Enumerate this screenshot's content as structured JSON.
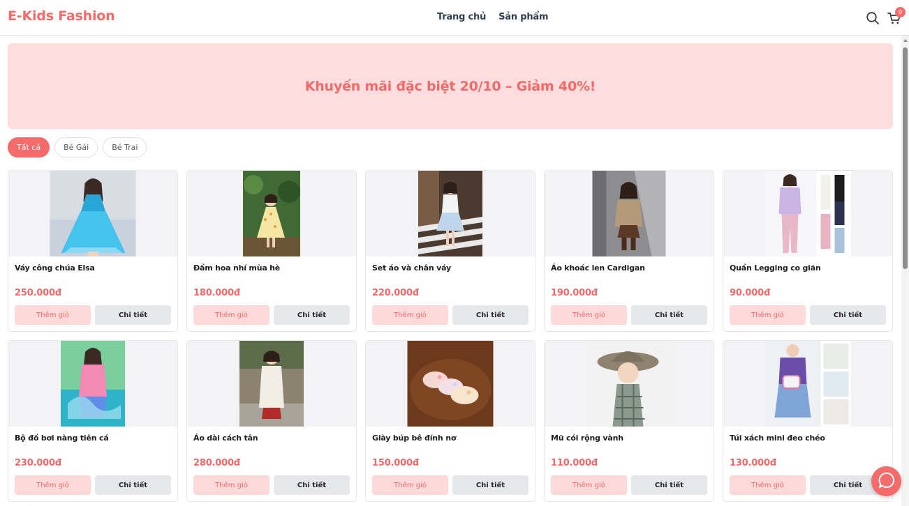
{
  "header": {
    "logo": "E-Kids Fashion",
    "nav": [
      "Trang chủ",
      "Sản phẩm"
    ],
    "cart_count": "0"
  },
  "banner": {
    "text": "Khuyến mãi đặc biệt 20/10 – Giảm 40%!"
  },
  "filters": [
    "Tất cả",
    "Bé Gái",
    "Bé Trai"
  ],
  "active_filter": "Tất cả",
  "products": [
    {
      "name": "Váy công chúa Elsa",
      "price": "250.000đ",
      "add_label": "Thêm giỏ",
      "detail_label": "Chi tiết"
    },
    {
      "name": "Đầm hoa nhí mùa hè",
      "price": "180.000đ",
      "add_label": "Thêm giỏ",
      "detail_label": "Chi tiết"
    },
    {
      "name": "Set áo và chân váy",
      "price": "220.000đ",
      "add_label": "Thêm giỏ",
      "detail_label": "Chi tiết"
    },
    {
      "name": "Áo khoác len Cardigan",
      "price": "190.000đ",
      "add_label": "Thêm giỏ",
      "detail_label": "Chi tiết"
    },
    {
      "name": "Quần Legging co giãn",
      "price": "90.000đ",
      "add_label": "Thêm giỏ",
      "detail_label": "Chi tiết"
    },
    {
      "name": "Bộ đồ bơi nàng tiên cá",
      "price": "230.000đ",
      "add_label": "Thêm giỏ",
      "detail_label": "Chi tiết"
    },
    {
      "name": "Áo dài cách tân",
      "price": "280.000đ",
      "add_label": "Thêm giỏ",
      "detail_label": "Chi tiết"
    },
    {
      "name": "Giày búp bê đính nơ",
      "price": "150.000đ",
      "add_label": "Thêm giỏ",
      "detail_label": "Chi tiết"
    },
    {
      "name": "Mũ cói rộng vành",
      "price": "110.000đ",
      "add_label": "Thêm giỏ",
      "detail_label": "Chi tiết"
    },
    {
      "name": "Túi xách mini đeo chéo",
      "price": "130.000đ",
      "add_label": "Thêm giỏ",
      "detail_label": "Chi tiết"
    }
  ],
  "colors": {
    "accent": "#f46b6b",
    "banner_bg": "#fddddd",
    "button_bg": "#e5e7eb"
  },
  "icons": {
    "search": "search-icon",
    "cart": "cart-icon",
    "chat": "chat-icon"
  }
}
